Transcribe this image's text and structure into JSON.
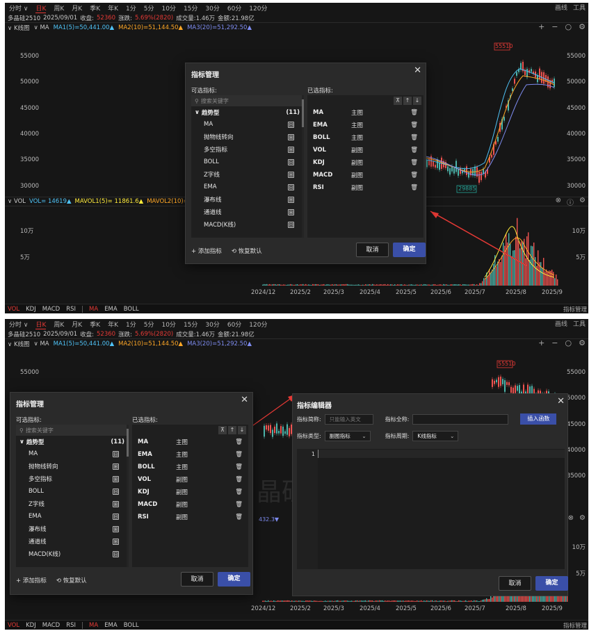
{
  "timeframes": [
    "分时",
    "日K",
    "周K",
    "月K",
    "季K",
    "年K",
    "1分",
    "5分",
    "10分",
    "15分",
    "30分",
    "60分",
    "120分"
  ],
  "tf_top_caret": "∨",
  "top_right": [
    "画线",
    "工具"
  ],
  "info": {
    "symbol": "多晶硅2510",
    "date": "2025/09/01",
    "close_label": "收盘:",
    "close": "52360",
    "change_label": "涨跌:",
    "change": "5.69%(2820)",
    "vol": "成交量:1.46万",
    "amt": "金额:21.98亿"
  },
  "kline": {
    "label": "K线图",
    "ma_label": "MA",
    "ma1": "MA1(5)=50,441.00▲",
    "ma2": "MA2(10)=51,144.50▲",
    "ma3": "MA3(20)=51,292.50▲",
    "controls": [
      "+",
      "−",
      "○",
      "⚙"
    ]
  },
  "price_axis": [
    "55000",
    "50000",
    "45000",
    "40000",
    "35000",
    "30000"
  ],
  "high_label": "55510",
  "low_label": "29885",
  "vol": {
    "label": "VOL",
    "vol": "VOL= 14619▲",
    "mavol1": "MAVOL1(5)= 11861.6▲",
    "mavol2": "MAVOL2(10)= 12€",
    "right_icons": [
      "⊗",
      "ⓘ",
      "⚙"
    ],
    "axis": [
      "10万",
      "5万"
    ],
    "vol2_tail": "432.3▼"
  },
  "x_axis": [
    "2024/12",
    "2025/2",
    "2025/3",
    "2025/4",
    "2025/5",
    "2025/6",
    "2025/7",
    "2025/8",
    "2025/9"
  ],
  "bottom": {
    "left": [
      "VOL",
      "KDJ",
      "MACD",
      "RSI"
    ],
    "right": [
      "MA",
      "EMA",
      "BOLL"
    ],
    "corner": "指标管理"
  },
  "dialog": {
    "title": "指标管理",
    "close": "✕",
    "available_label": "可选指标:",
    "selected_label": "已选指标:",
    "search_placeholder": "搜索关键字",
    "group": "趋势型",
    "group_count": "(11)",
    "items": [
      {
        "n": "MA",
        "b": "⊟"
      },
      {
        "n": "抛物线转向",
        "b": "⊞"
      },
      {
        "n": "多空指标",
        "b": "⊞"
      },
      {
        "n": "BOLL",
        "b": "⊟"
      },
      {
        "n": "Z字线",
        "b": "⊞"
      },
      {
        "n": "EMA",
        "b": "⊟"
      },
      {
        "n": "瀑布线",
        "b": "⊞"
      },
      {
        "n": "通道线",
        "b": "⊞"
      },
      {
        "n": "MACD(K线)",
        "b": "⊟"
      }
    ],
    "selected": [
      {
        "n": "MA",
        "t": "主图"
      },
      {
        "n": "EMA",
        "t": "主图"
      },
      {
        "n": "BOLL",
        "t": "主图"
      },
      {
        "n": "VOL",
        "t": "副图"
      },
      {
        "n": "KDJ",
        "t": "副图"
      },
      {
        "n": "MACD",
        "t": "副图"
      },
      {
        "n": "RSI",
        "t": "副图"
      }
    ],
    "tools": [
      "⊼",
      "↑",
      "↓"
    ],
    "del": "🗑",
    "add": "+ 添加指标",
    "restore": "⟲ 恢复默认",
    "cancel": "取消",
    "ok": "确定"
  },
  "editor": {
    "title": "指标编辑器",
    "close": "✕",
    "short_label": "指标简称:",
    "short_placeholder": "只能输入英文",
    "full_label": "指标全称:",
    "insert": "插入函数",
    "type_label": "指标类型:",
    "type_value": "副图指标",
    "period_label": "指标周期:",
    "period_value": "K线指标",
    "line_no": "1",
    "cancel": "取消",
    "ok": "确定"
  },
  "watermark": "晶硅"
}
